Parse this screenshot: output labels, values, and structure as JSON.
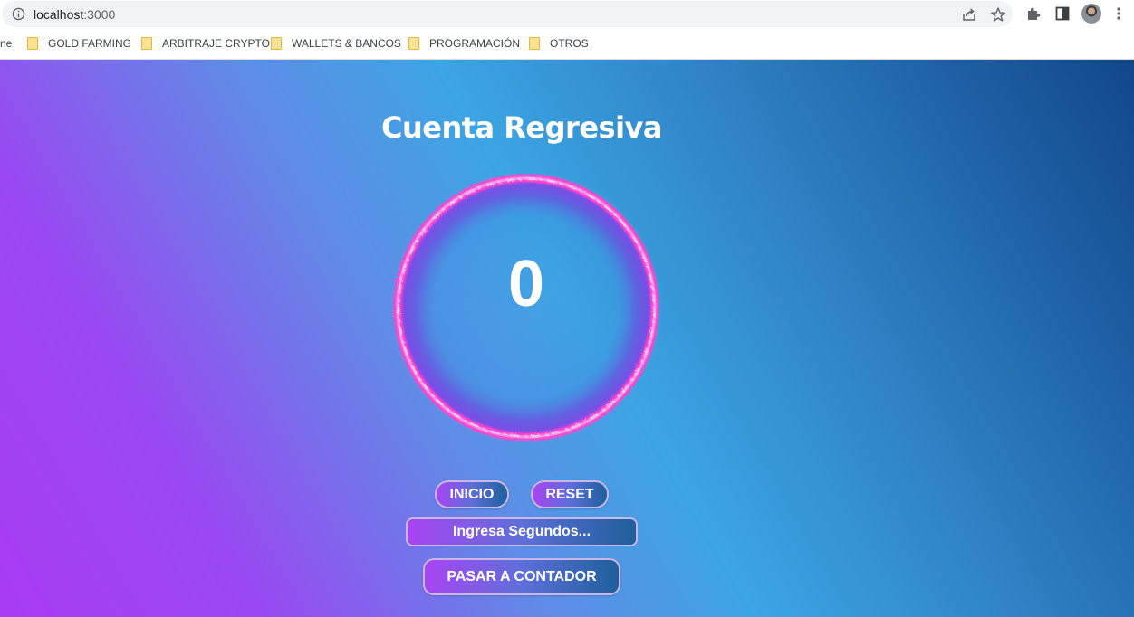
{
  "browser": {
    "url_host": "localhost",
    "url_port": ":3000",
    "bookmarks": {
      "partial": "ne",
      "items": [
        {
          "label": "GOLD FARMING"
        },
        {
          "label": "ARBITRAJE CRYPTO"
        },
        {
          "label": "WALLETS & BANCOS"
        },
        {
          "label": "PROGRAMACIÓN"
        },
        {
          "label": "OTROS"
        }
      ]
    }
  },
  "app": {
    "title": "Cuenta Regresiva",
    "counter_value": "0",
    "start_label": "INICIO",
    "reset_label": "RESET",
    "seconds_placeholder": "Ingresa Segundos...",
    "switch_label": "PASAR A CONTADOR"
  },
  "colors": {
    "gradient_left": "#a83cf3",
    "gradient_mid": "#3ca5e3",
    "gradient_right": "#12478a",
    "ring": "#ff3fd0"
  }
}
